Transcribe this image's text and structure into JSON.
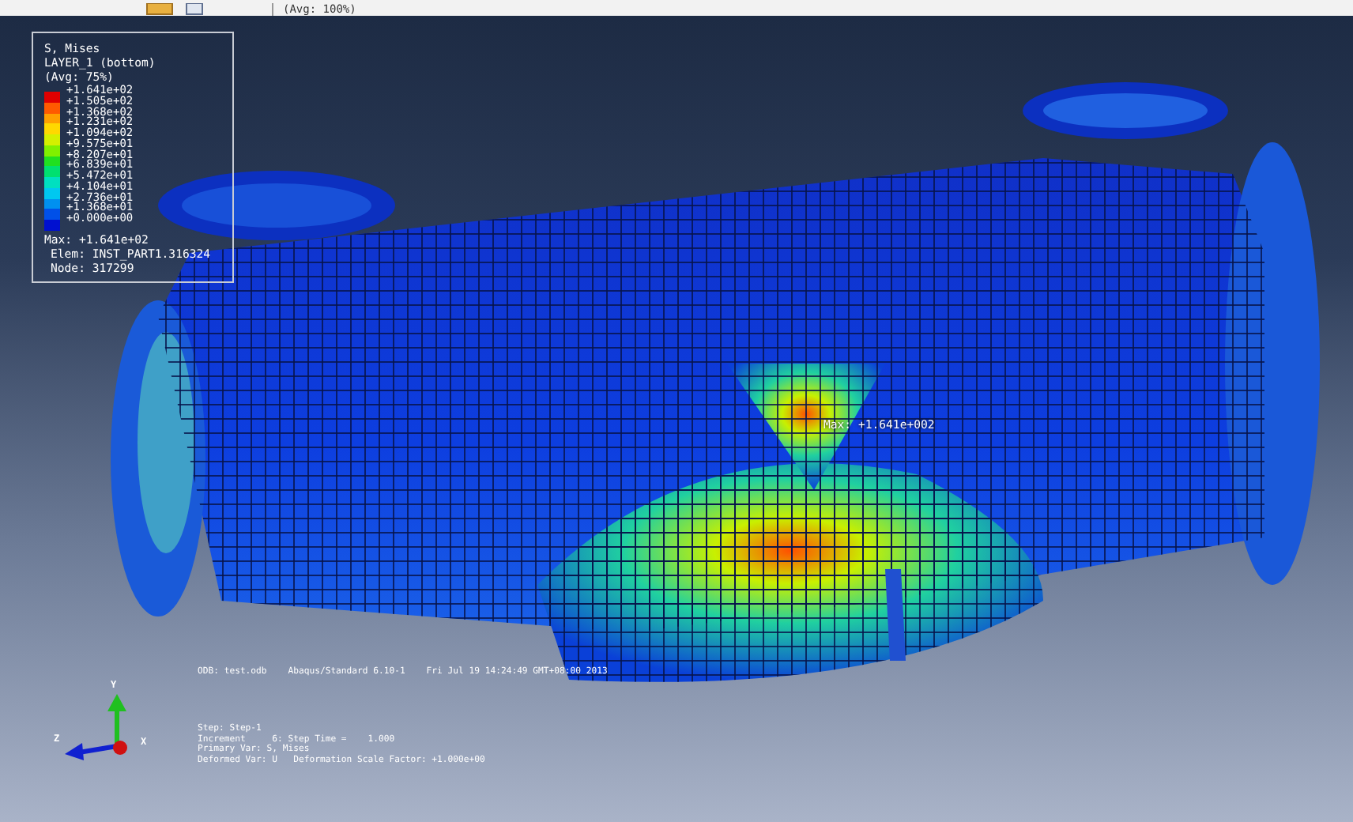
{
  "top_strip": {
    "legend_fragment": "(Avg: 100%)"
  },
  "legend": {
    "title_lines": [
      "S, Mises",
      "LAYER_1 (bottom)",
      "(Avg: 75%)"
    ],
    "bands": [
      {
        "label": "+1.641e+02",
        "color": "#e00000"
      },
      {
        "label": "+1.505e+02",
        "color": "#ff5a00"
      },
      {
        "label": "+1.368e+02",
        "color": "#ffa000"
      },
      {
        "label": "+1.231e+02",
        "color": "#ffd800"
      },
      {
        "label": "+1.094e+02",
        "color": "#d4f000"
      },
      {
        "label": "+9.575e+01",
        "color": "#80f000"
      },
      {
        "label": "+8.207e+01",
        "color": "#20e020"
      },
      {
        "label": "+6.839e+01",
        "color": "#00e070"
      },
      {
        "label": "+5.472e+01",
        "color": "#00e0c0"
      },
      {
        "label": "+4.104e+01",
        "color": "#00c8f0"
      },
      {
        "label": "+2.736e+01",
        "color": "#0090f0"
      },
      {
        "label": "+1.368e+01",
        "color": "#0050e8"
      },
      {
        "label": "+0.000e+00",
        "color": "#0010d0"
      }
    ],
    "max": "Max: +1.641e+02",
    "elem": "Elem: INST_PART1.316324",
    "node": "Node: 317299"
  },
  "model": {
    "max_marker": "Max: +1.641e+002"
  },
  "triad": {
    "y": "Y",
    "z": "Z",
    "x": "X"
  },
  "info": {
    "odb_line": "ODB: test.odb    Abaqus/Standard 6.10-1    Fri Jul 19 14:24:49 GMT+08:00 2013",
    "step_lines": [
      "Step: Step-1",
      "Increment     6: Step Time =    1.000",
      "Primary Var: S, Mises",
      "Deformed Var: U   Deformation Scale Factor: +1.000e+00"
    ]
  }
}
